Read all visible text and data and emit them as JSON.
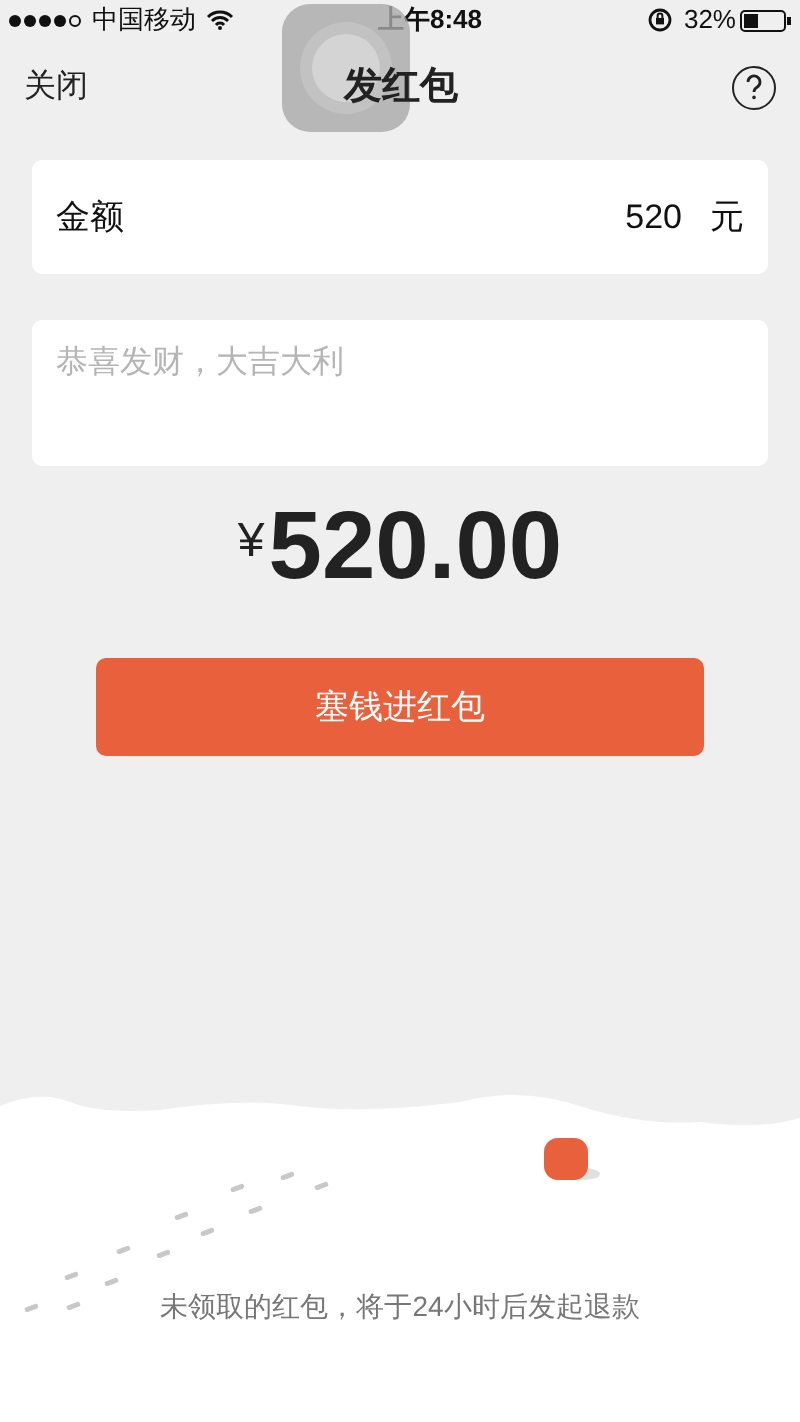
{
  "status_bar": {
    "carrier": "中国移动",
    "time": "上午8:48",
    "battery": "32%"
  },
  "nav": {
    "close": "关闭",
    "title": "发红包"
  },
  "amount_field": {
    "label": "金额",
    "value": "520",
    "unit": "元"
  },
  "greeting_field": {
    "placeholder": "恭喜发财，大吉大利"
  },
  "total": {
    "currency": "¥",
    "amount": "520.00"
  },
  "submit_button": "塞钱进红包",
  "footer_note": "未领取的红包，将于24小时后发起退款"
}
